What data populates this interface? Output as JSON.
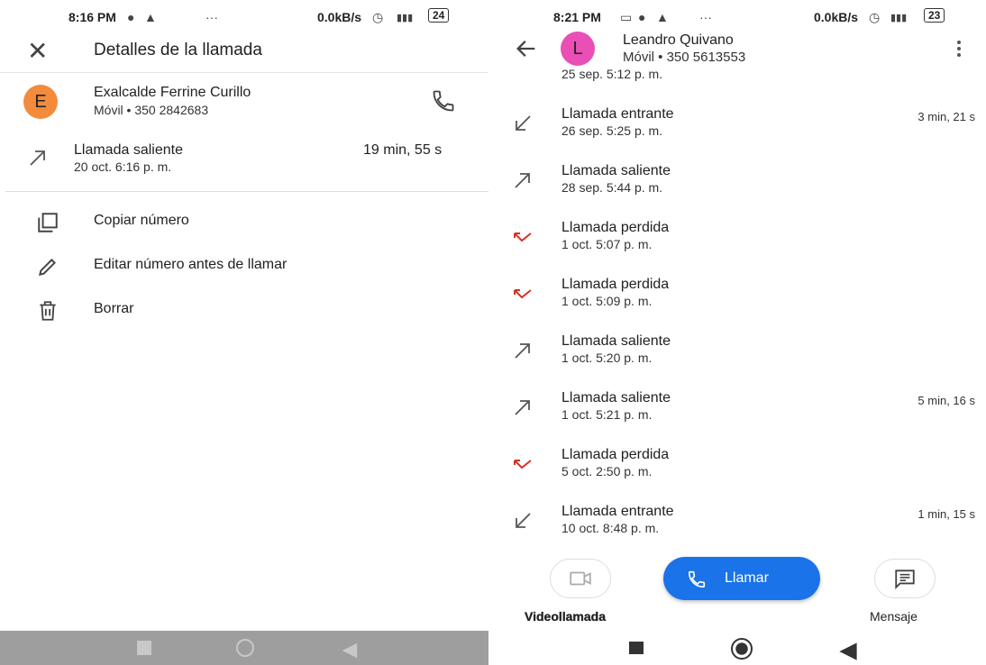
{
  "left": {
    "status": {
      "time": "8:16 PM",
      "dots": "···",
      "speed": "0.0kB/s",
      "battery": "24"
    },
    "title": "Detalles de la llamada",
    "contact": {
      "initial": "E",
      "name": "Exalcalde Ferrine Curillo",
      "sub": "Móvil • 350 2842683",
      "avatar_color": "#f28b3c"
    },
    "call": {
      "type": "Llamada saliente",
      "date": "20 oct. 6:16 p. m.",
      "duration": "19 min, 55 s"
    },
    "actions": [
      {
        "label": "Copiar número",
        "icon": "copy-icon"
      },
      {
        "label": "Editar número antes de llamar",
        "icon": "pencil-icon"
      },
      {
        "label": "Borrar",
        "icon": "trash-icon"
      }
    ]
  },
  "right": {
    "status": {
      "time": "8:21 PM",
      "dots": "···",
      "speed": "0.0kB/s",
      "battery": "23"
    },
    "contact": {
      "initial": "L",
      "name": "Leandro Quivano",
      "sub": "Móvil • 350 5613553",
      "avatar_color": "#e94fb5"
    },
    "partial_date": "25 sep. 5:12 p. m.",
    "calls": [
      {
        "type": "Llamada entrante",
        "date": "26 sep. 5:25 p. m.",
        "duration": "3 min, 21 s",
        "kind": "incoming"
      },
      {
        "type": "Llamada saliente",
        "date": "28 sep. 5:44 p. m.",
        "duration": "",
        "kind": "outgoing"
      },
      {
        "type": "Llamada perdida",
        "date": "1 oct. 5:07 p. m.",
        "duration": "",
        "kind": "missed"
      },
      {
        "type": "Llamada perdida",
        "date": "1 oct. 5:09 p. m.",
        "duration": "",
        "kind": "missed"
      },
      {
        "type": "Llamada saliente",
        "date": "1 oct. 5:20 p. m.",
        "duration": "",
        "kind": "outgoing"
      },
      {
        "type": "Llamada saliente",
        "date": "1 oct. 5:21 p. m.",
        "duration": "5 min, 16 s",
        "kind": "outgoing"
      },
      {
        "type": "Llamada perdida",
        "date": "5 oct. 2:50 p. m.",
        "duration": "",
        "kind": "missed"
      },
      {
        "type": "Llamada entrante",
        "date": "10 oct. 8:48 p. m.",
        "duration": "1 min, 15 s",
        "kind": "incoming"
      }
    ],
    "video_label": "Videollamada",
    "call_label": "Llamar",
    "message_label": "Mensaje",
    "accent": "#1a73e8",
    "missed_color": "#d93025"
  }
}
